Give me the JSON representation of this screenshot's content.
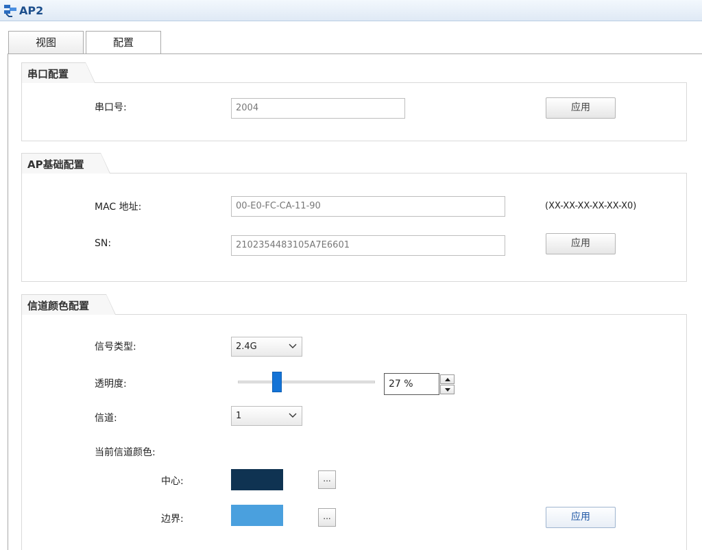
{
  "window": {
    "title": "AP2",
    "icon": "network-device-icon"
  },
  "tabs": [
    {
      "label": "视图"
    },
    {
      "label": "配置"
    }
  ],
  "serial_config": {
    "legend": "串口配置",
    "port_label": "串口号:",
    "port_value": "2004",
    "apply_label": "应用"
  },
  "ap_basic_config": {
    "legend": "AP基础配置",
    "mac_label": "MAC 地址:",
    "mac_value": "00-E0-FC-CA-11-90",
    "mac_format_hint": "(XX-XX-XX-XX-XX-X0)",
    "sn_label": "SN:",
    "sn_value": "2102354483105A7E6601",
    "apply_label": "应用"
  },
  "channel_color_config": {
    "legend": "信道颜色配置",
    "signal_type_label": "信号类型:",
    "signal_type_value": "2.4G",
    "transparency_label": "透明度:",
    "transparency_percent": 27,
    "transparency_text": "27 %",
    "channel_label": "信道:",
    "channel_value": "1",
    "current_color_label": "当前信道颜色:",
    "center_label": "中心:",
    "center_color": "#0f3352",
    "border_label": "边界:",
    "border_color": "#4aa0de",
    "dots_label": "...",
    "apply_label": "应用"
  }
}
